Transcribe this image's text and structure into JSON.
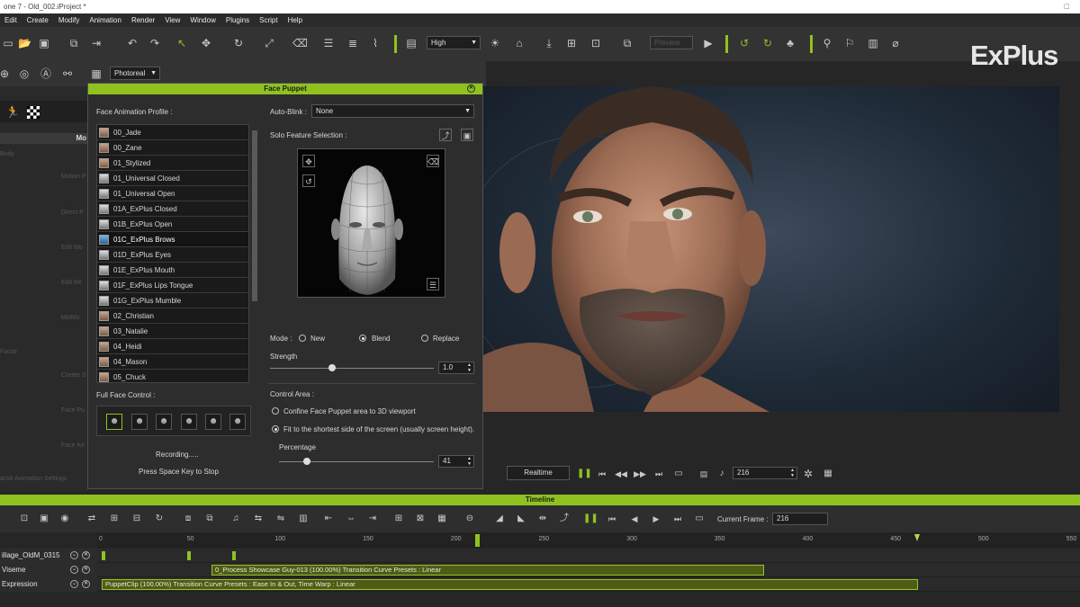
{
  "window": {
    "title": "one 7 - Old_002.iProject *",
    "controls": "□"
  },
  "menu": [
    "Edit",
    "Create",
    "Modify",
    "Animation",
    "Render",
    "View",
    "Window",
    "Plugins",
    "Script",
    "Help"
  ],
  "toolbar": {
    "quality": "High",
    "preview": "Preview",
    "render_mode": "Photoreal"
  },
  "logo": "ExPlus",
  "left_panel": {
    "tab_label": "Mo",
    "items": [
      "Body",
      "Motion P",
      "Direct P",
      "Edit Mo",
      "Edit Re",
      "MixMo",
      "Facial",
      "Create S",
      "Face Pu",
      "Face Ke",
      "acial Animation Settings"
    ]
  },
  "face_puppet": {
    "title": "Face Puppet",
    "profile_label": "Face Animation Profile :",
    "profiles": [
      {
        "name": "00_Jade",
        "thumb": "photo"
      },
      {
        "name": "00_Zane",
        "thumb": "photo"
      },
      {
        "name": "01_Stylized",
        "thumb": "photo"
      },
      {
        "name": "01_Universal Closed",
        "thumb": "mask"
      },
      {
        "name": "01_Universal Open",
        "thumb": "mask"
      },
      {
        "name": "01A_ExPlus Closed",
        "thumb": "mask"
      },
      {
        "name": "01B_ExPlus Open",
        "thumb": "mask"
      },
      {
        "name": "01C_ExPlus Brows",
        "thumb": "selected"
      },
      {
        "name": "01D_ExPlus Eyes",
        "thumb": "mask"
      },
      {
        "name": "01E_ExPlus Mouth",
        "thumb": "mask"
      },
      {
        "name": "01F_ExPlus Lips Tongue",
        "thumb": "mask"
      },
      {
        "name": "01G_ExPlus Mumble",
        "thumb": "mask"
      },
      {
        "name": "02_Christian",
        "thumb": "photo"
      },
      {
        "name": "03_Natalie",
        "thumb": "photo"
      },
      {
        "name": "04_Heidi",
        "thumb": "photo"
      },
      {
        "name": "04_Mason",
        "thumb": "photo"
      },
      {
        "name": "05_Chuck",
        "thumb": "photo"
      }
    ],
    "selected_profile": "01C_ExPlus Brows",
    "full_face_label": "Full Face Control :",
    "recording": "Recording.....",
    "stop_hint": "Press Space Key to Stop",
    "auto_blink_label": "Auto-Blink :",
    "auto_blink_value": "None",
    "solo_label": "Solo Feature Selection :",
    "mode_label": "Mode :",
    "modes": [
      "New",
      "Blend",
      "Replace"
    ],
    "mode_selected": "Blend",
    "strength_label": "Strength",
    "strength_value": "1.0",
    "strength_level": 0.38,
    "control_area_label": "Control Area :",
    "control_options": [
      "Confine Face Puppet area to 3D viewport",
      "Fit to the shortest side of the screen (usually screen height)."
    ],
    "control_selected": 1,
    "percentage_label": "Percentage",
    "percentage_value": "41",
    "percentage_level": 0.18
  },
  "playback": {
    "mode": "Realtime",
    "frame": "216"
  },
  "timeline": {
    "title": "Timeline",
    "current_frame_label": "Current Frame :",
    "current_frame": "216",
    "ticks": [
      "0",
      "50",
      "100",
      "150",
      "200",
      "250",
      "300",
      "350",
      "400",
      "450",
      "500",
      "550"
    ],
    "tracks": [
      {
        "name": "illage_OldM_0315",
        "clip": ""
      },
      {
        "name": "Viseme",
        "clip": "0_Process Showcase Guy-013 (100.00%) Transition Curve Presets : Linear"
      },
      {
        "name": "Expression",
        "clip": "PuppetClip (100.00%) Transition Curve Presets : Ease In & Out, Time Warp : Linear"
      }
    ]
  },
  "colors": {
    "accent": "#8fc21f",
    "bg": "#262626",
    "panel": "#2d2d2d"
  }
}
